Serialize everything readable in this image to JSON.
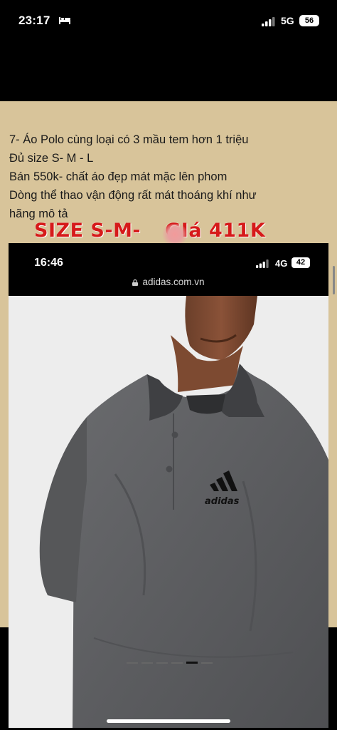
{
  "status_bar": {
    "time": "23:17",
    "network": "5G",
    "battery": "56"
  },
  "post": {
    "lines": [
      "7- Áo Polo cùng loại có 3 mầu tem hơn 1 triệu",
      "Đủ size S- M - L",
      "Bán 550k- chất áo đẹp mát mặc lên phom",
      "Dòng thể thao vận động rất mát thoáng khí như",
      "hãng mô tả"
    ],
    "price_banner": {
      "left": "SIZE S-M-",
      "right": "GIá 411K",
      "color": "#d61a1a"
    }
  },
  "inner_screenshot": {
    "time": "16:46",
    "network": "4G",
    "battery": "42",
    "url": "adidas.com.vn",
    "brand_logo_text": "adidas",
    "carousel": {
      "count": 6,
      "active_index": 4
    }
  },
  "colors": {
    "background": "#d8c49a",
    "shirt": "#5f6063",
    "price": "#d61a1a"
  }
}
